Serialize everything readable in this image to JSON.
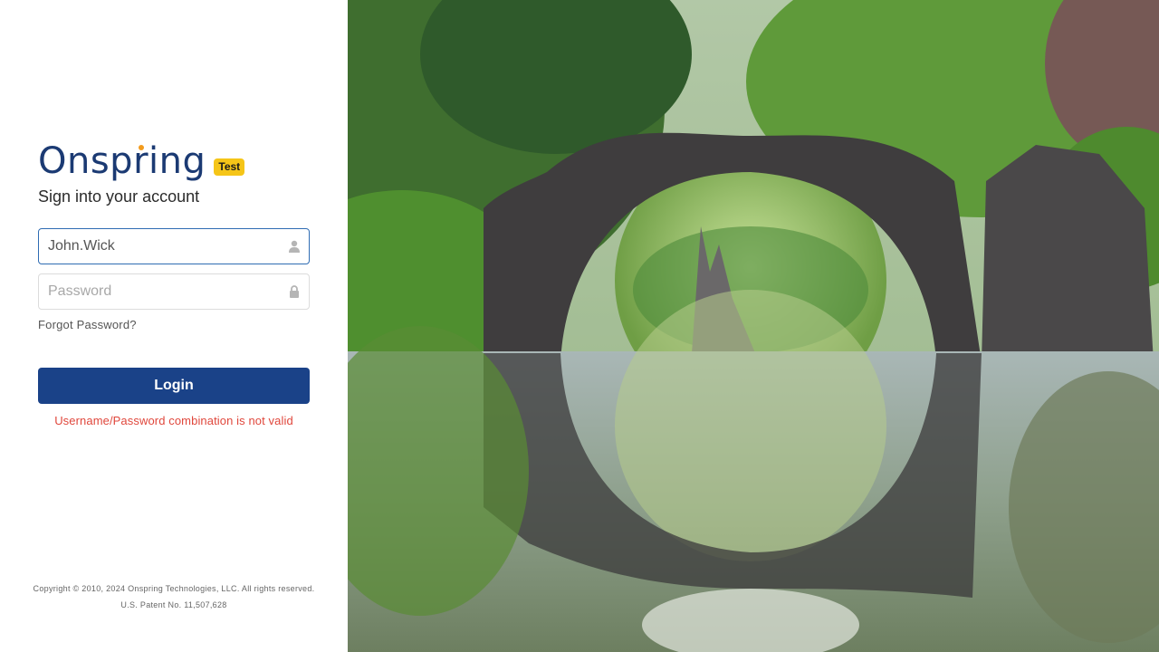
{
  "colors": {
    "brand_blue": "#1b3a73",
    "login_button": "#1a4288",
    "badge_yellow": "#f5c518",
    "error_red": "#e0473c",
    "logo_dot_orange": "#f29b1d",
    "focus_border": "#2f6cb3"
  },
  "brand": {
    "logo_text": "Onspring",
    "env_badge": "Test"
  },
  "login_form": {
    "title": "Sign into your account",
    "username": {
      "value": "John.Wick",
      "icon": "user-icon"
    },
    "password": {
      "placeholder": "Password",
      "icon": "lock-icon"
    },
    "forgot_password": "Forgot Password?",
    "login_label": "Login",
    "error": "Username/Password combination is not valid"
  },
  "footer": {
    "copyright": "Copyright © 2010, 2024 Onspring Technologies, LLC. All rights reserved.",
    "patent": "U.S. Patent No. 11,507,628"
  }
}
